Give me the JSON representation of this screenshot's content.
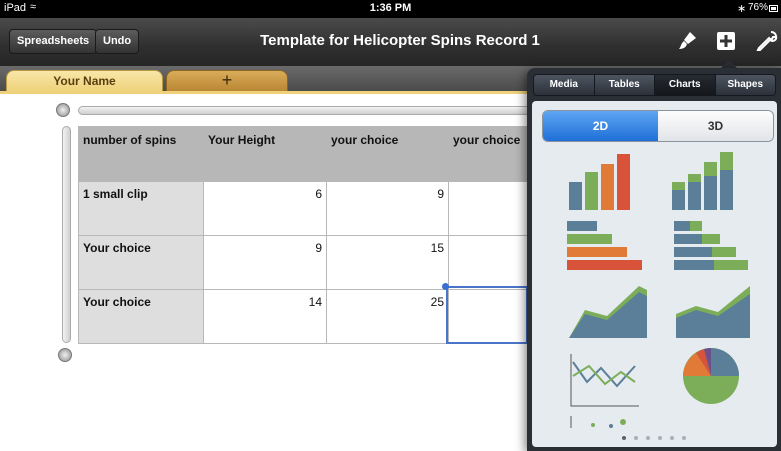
{
  "status_bar": {
    "carrier": "iPad",
    "time": "1:36 PM",
    "battery": "76%"
  },
  "toolbar": {
    "spreadsheets_label": "Spreadsheets",
    "undo_label": "Undo",
    "title": "Template for Helicopter Spins Record 1",
    "icons": [
      "paintbrush-icon",
      "plus-icon",
      "wrench-icon"
    ]
  },
  "tabs": {
    "active_label": "Your Name",
    "add_label": "+"
  },
  "table": {
    "headers": [
      "number of spins",
      "Your Height",
      "your choice",
      "your choice"
    ],
    "rows": [
      {
        "label": "1 small clip",
        "values": [
          "6",
          "9",
          ""
        ]
      },
      {
        "label": "Your choice",
        "values": [
          "9",
          "15",
          ""
        ]
      },
      {
        "label": "Your choice",
        "values": [
          "14",
          "25",
          ""
        ]
      }
    ]
  },
  "popover": {
    "tabs": [
      "Media",
      "Tables",
      "Charts",
      "Shapes"
    ],
    "selected_tab": "Charts",
    "dimension_options": [
      "2D",
      "3D"
    ],
    "selected_dimension": "2D",
    "chart_thumbnails": [
      "column-chart",
      "stacked-column-chart",
      "bar-chart",
      "stacked-bar-chart",
      "area-chart",
      "stacked-area-chart",
      "line-chart",
      "pie-chart",
      "scatter-chart"
    ],
    "page_count": 6,
    "current_page": 1,
    "colors": {
      "blue": "#5b7f99",
      "green": "#7cae5a",
      "orange": "#e07a36",
      "red": "#d8533a",
      "purple": "#6b4f8a"
    }
  }
}
